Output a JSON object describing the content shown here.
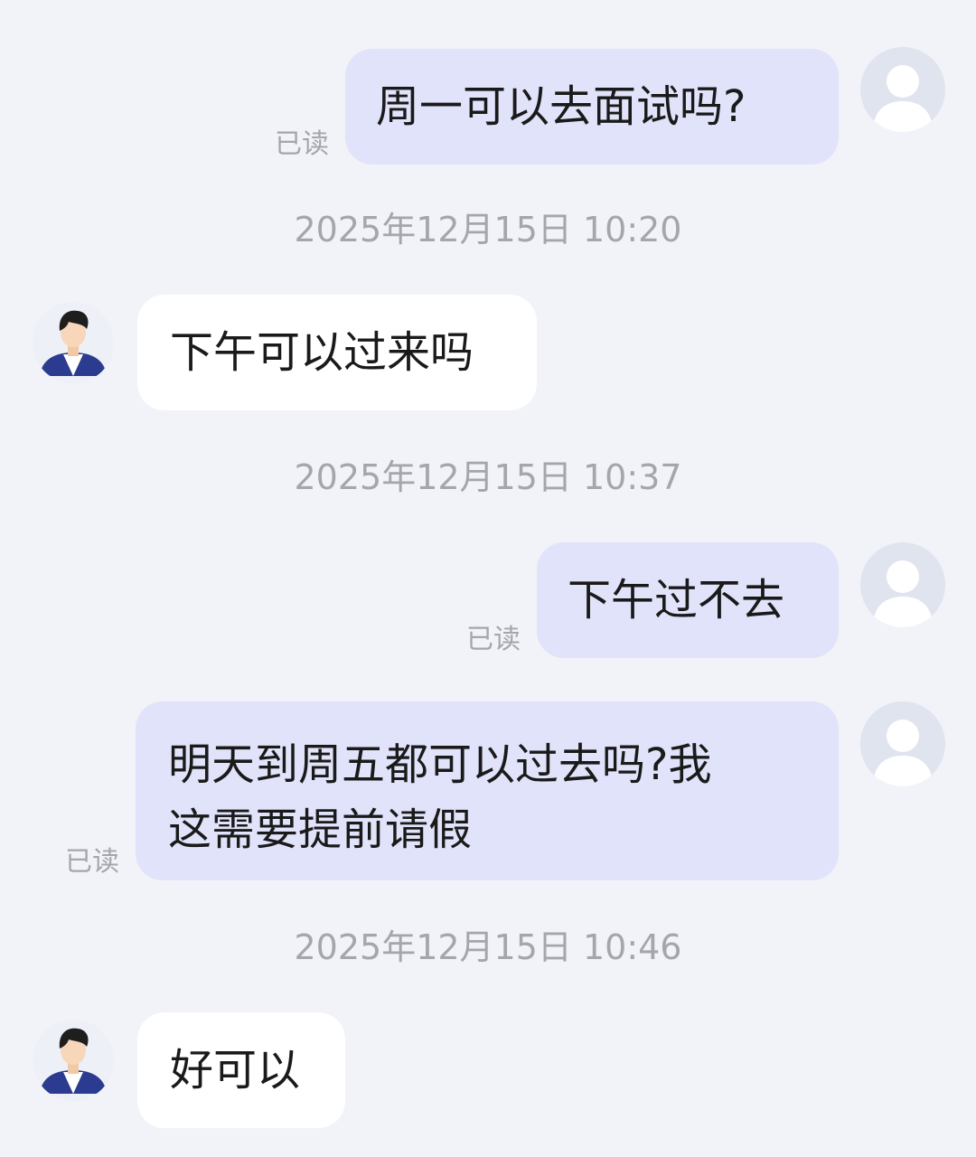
{
  "colors": {
    "background": "#f1f3f8",
    "outgoing_bubble": "#e1e3fa",
    "incoming_bubble": "#ffffff",
    "meta_text": "#a4a6ad"
  },
  "messages": [
    {
      "direction": "outgoing",
      "text": "周一可以去面试吗?",
      "read_label": "已读",
      "avatar": "default-user-avatar"
    },
    {
      "type": "timestamp",
      "text": "2025年12月15日 10:20"
    },
    {
      "direction": "incoming",
      "text": "下午可以过来吗",
      "avatar": "recruiter-avatar"
    },
    {
      "type": "timestamp",
      "text": "2025年12月15日 10:37"
    },
    {
      "direction": "outgoing",
      "text": "下午过不去",
      "read_label": "已读",
      "avatar": "default-user-avatar"
    },
    {
      "direction": "outgoing",
      "lines": [
        "明天到周五都可以过去吗?我",
        "这需要提前请假"
      ],
      "read_label": "已读",
      "avatar": "default-user-avatar"
    },
    {
      "type": "timestamp",
      "text": "2025年12月15日 10:46"
    },
    {
      "direction": "incoming",
      "text": "好可以",
      "avatar": "recruiter-avatar"
    }
  ]
}
